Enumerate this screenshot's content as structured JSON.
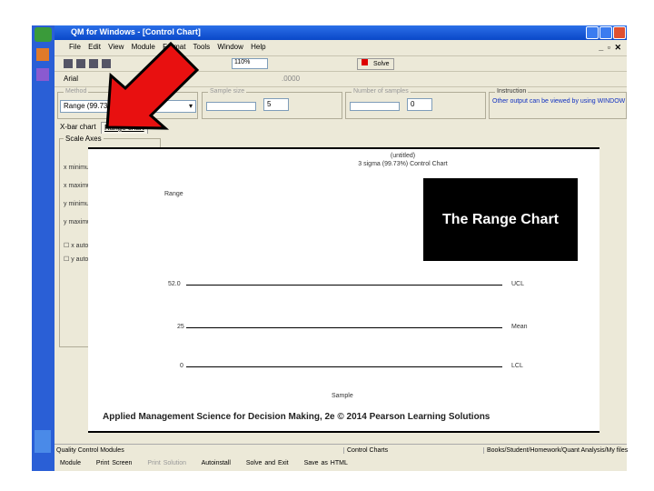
{
  "window": {
    "title": "QM for Windows - [Control Chart]"
  },
  "menu": [
    "File",
    "Edit",
    "View",
    "Module",
    "Format",
    "Tools",
    "Window",
    "Help"
  ],
  "toolbar": {
    "zoom": "110%",
    "solve_label": "Solve",
    "font": "Arial",
    "number_format": ".0000"
  },
  "panels": {
    "method": {
      "label": "Method",
      "value": "Range (99.73%)"
    },
    "sample_size": {
      "label": "Sample size",
      "value": "5"
    },
    "number_of_samples": {
      "label": "Number of samples",
      "value": "0"
    },
    "instruction": {
      "label": "Instruction",
      "text": "Other output can be viewed by using WINDOW"
    }
  },
  "tabs": [
    {
      "label": "X-bar chart"
    },
    {
      "label": "Range chart"
    }
  ],
  "scale_axes": {
    "label": "Scale Axes",
    "rows": [
      "x minimum",
      "x maximum",
      "y minimum",
      "y maximum"
    ],
    "checks": [
      "x auto",
      "y auto"
    ]
  },
  "chart": {
    "title": "(untitled)",
    "subtitle": "3 sigma (99.73%) Control Chart",
    "ylabel": "Range",
    "xlabel": "Sample",
    "lines": [
      {
        "name": "UCL",
        "value": "52.0"
      },
      {
        "name": "Mean",
        "value": "25"
      },
      {
        "name": "LCL",
        "value": "0"
      }
    ]
  },
  "overlay": {
    "caption": "The Range Chart",
    "footer": "Applied Management Science for Decision Making, 2e © 2014 Pearson Learning Solutions"
  },
  "status": {
    "left": "Quality Control Modules",
    "mid": "Control Charts",
    "right": "Books/Student/Homework/Quant Analysis/My files"
  },
  "taskbar": [
    "Module",
    "Print Screen",
    "Print Solution",
    "Autoinstall",
    "Solve and Exit",
    "Save as HTML"
  ],
  "colors": {
    "titlebar": "#0a48c8",
    "arrow": "#e81010",
    "overlay": "#000000"
  }
}
